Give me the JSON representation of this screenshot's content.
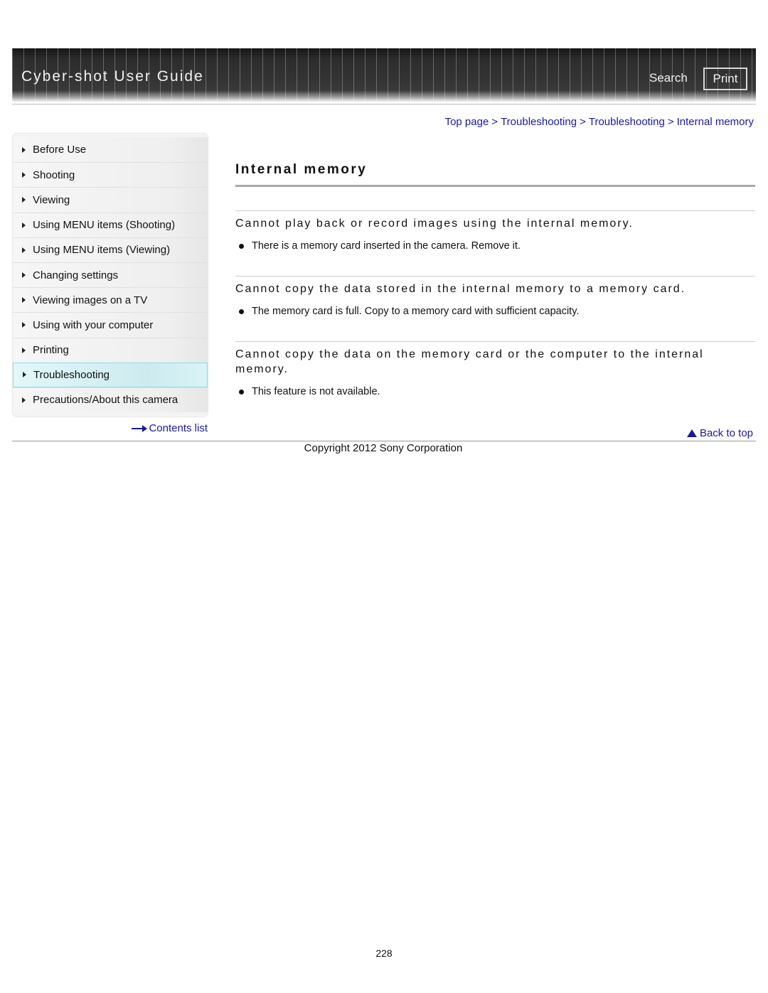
{
  "header": {
    "title": "Cyber-shot User Guide",
    "search_label": "Search",
    "print_label": "Print"
  },
  "breadcrumb": {
    "items": [
      "Top page",
      "Troubleshooting",
      "Troubleshooting",
      "Internal memory"
    ],
    "separator": ">"
  },
  "sidebar": {
    "items": [
      {
        "label": "Before Use"
      },
      {
        "label": "Shooting"
      },
      {
        "label": "Viewing"
      },
      {
        "label": "Using MENU items (Shooting)"
      },
      {
        "label": "Using MENU items (Viewing)"
      },
      {
        "label": "Changing settings"
      },
      {
        "label": "Viewing images on a TV"
      },
      {
        "label": "Using with your computer"
      },
      {
        "label": "Printing"
      },
      {
        "label": "Troubleshooting",
        "active": true
      },
      {
        "label": "Precautions/About this camera"
      }
    ],
    "contents_link": "Contents list"
  },
  "main": {
    "title": "Internal memory",
    "sections": [
      {
        "heading": "Cannot play back or record images using the internal memory.",
        "bullets": [
          "There is a memory card inserted in the camera. Remove it."
        ]
      },
      {
        "heading": "Cannot copy the data stored in the internal memory to a memory card.",
        "bullets": [
          "The memory card is full. Copy to a memory card with sufficient capacity."
        ]
      },
      {
        "heading": "Cannot copy the data on the memory card or the computer to the internal memory.",
        "bullets": [
          "This feature is not available."
        ]
      }
    ],
    "back_to_top": "Back to top"
  },
  "footer": {
    "copyright": "Copyright 2012 Sony Corporation",
    "page_number": "228"
  },
  "colors": {
    "link": "#1a1a9e",
    "active_item_bg": "#d6f1f4",
    "active_item_border": "#8fdbe6",
    "header_bg": "#333333"
  }
}
